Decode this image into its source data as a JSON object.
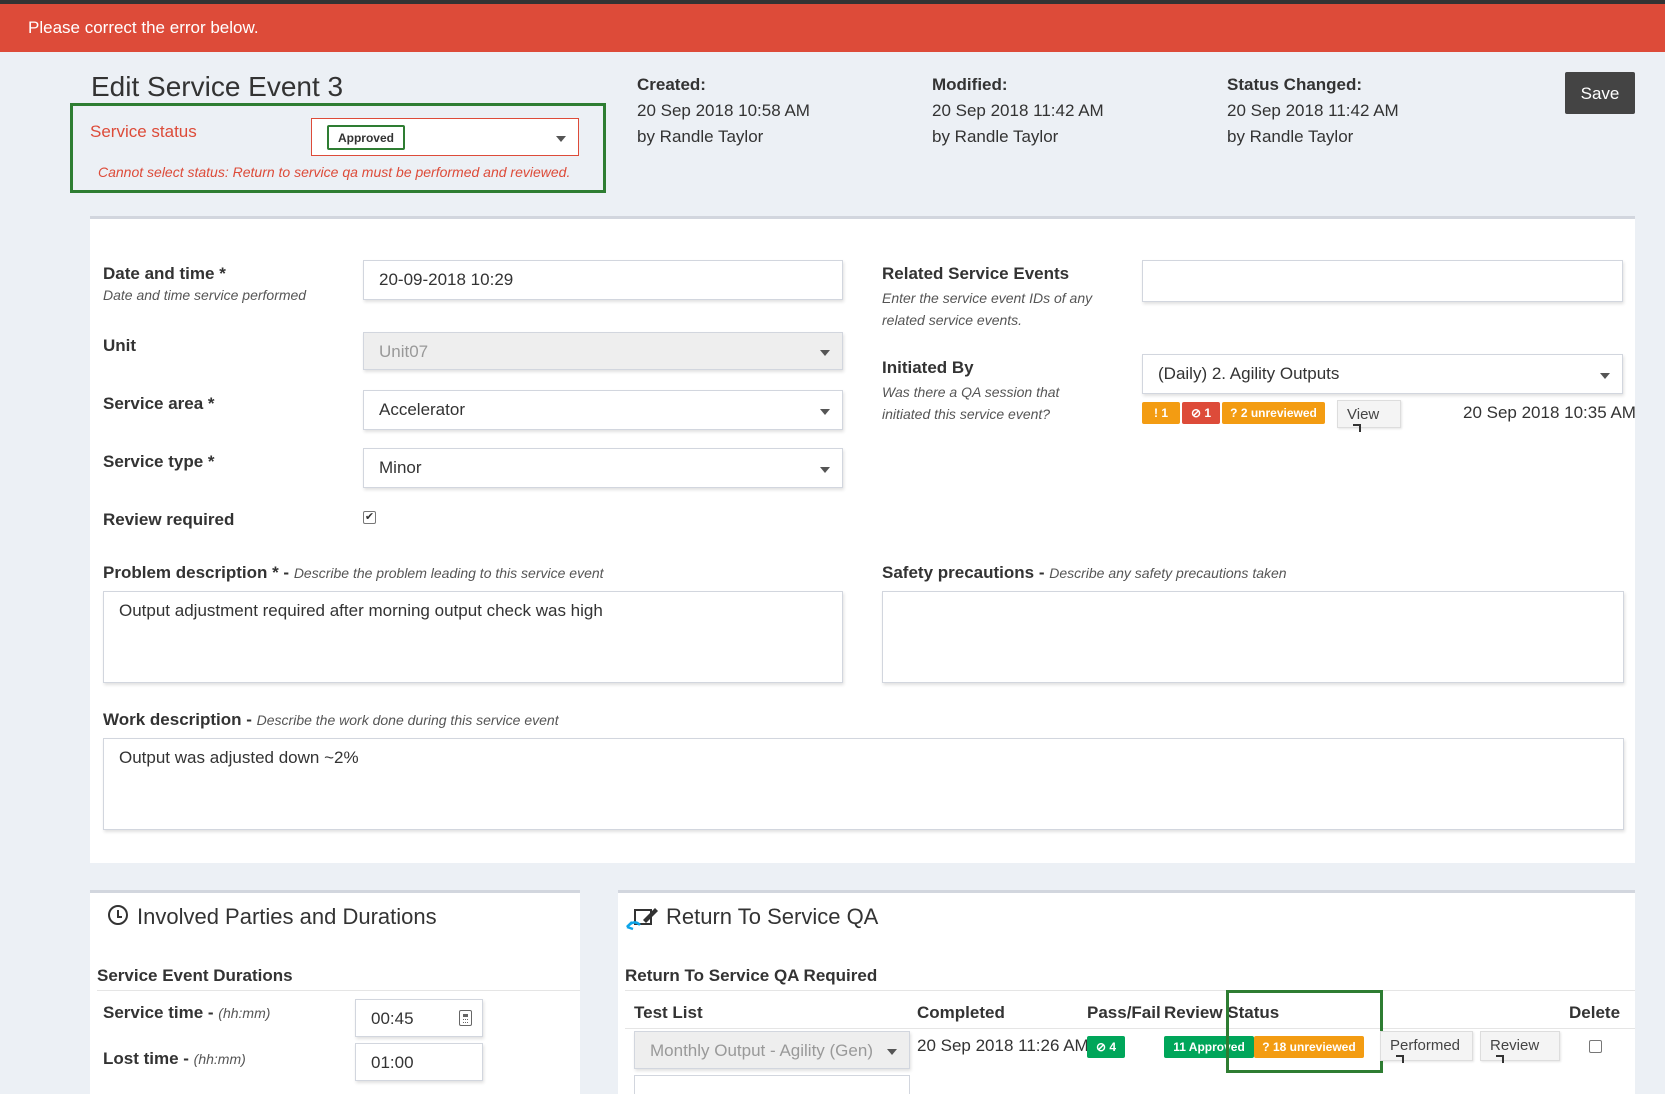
{
  "alert": {
    "message": "Please correct the error below."
  },
  "page": {
    "title": "Edit Service Event 3"
  },
  "status": {
    "label": "Service status",
    "selected": "Approved",
    "error": "Cannot select status: Return to service qa must be performed and reviewed."
  },
  "meta": {
    "created": {
      "heading": "Created:",
      "date": "20 Sep 2018 10:58 AM",
      "by": "by Randle Taylor"
    },
    "modified": {
      "heading": "Modified:",
      "date": "20 Sep 2018 11:42 AM",
      "by": "by Randle Taylor"
    },
    "status_changed": {
      "heading": "Status Changed:",
      "date": "20 Sep 2018 11:42 AM",
      "by": "by Randle Taylor"
    }
  },
  "toolbar": {
    "save_label": "Save"
  },
  "form": {
    "datetime": {
      "label": "Date and time *",
      "help": "Date and time service performed",
      "value": "20-09-2018 10:29"
    },
    "unit": {
      "label": "Unit",
      "value": "Unit07"
    },
    "service_area": {
      "label": "Service area *",
      "value": "Accelerator"
    },
    "service_type": {
      "label": "Service type *",
      "value": "Minor"
    },
    "review_required": {
      "label": "Review required",
      "checked": true
    },
    "related": {
      "label": "Related Service Events",
      "help": "Enter the service event IDs of any related service events.",
      "value": ""
    },
    "initiated_by": {
      "label": "Initiated By",
      "help": "Was there a QA session that initiated this service event?",
      "value": "(Daily) 2. Agility Outputs",
      "badges": [
        "1",
        "1",
        "2 unreviewed"
      ],
      "view_label": "View",
      "date": "20 Sep 2018 10:35 AM"
    },
    "problem": {
      "label": "Problem description *",
      "dash": " - ",
      "help": "Describe the problem leading to this service event",
      "value": "Output adjustment required after morning output check was high"
    },
    "safety": {
      "label": "Safety precautions",
      "dash": " - ",
      "help": "Describe any safety precautions taken",
      "value": ""
    },
    "work": {
      "label": "Work description",
      "dash": " - ",
      "help": "Describe the work done during this service event",
      "value": "Output was adjusted down ~2%"
    }
  },
  "parties": {
    "title": "Involved Parties and Durations",
    "durations_heading": "Service Event Durations",
    "service_time": {
      "label": "Service time",
      "dash": " - ",
      "help": "(hh:mm)",
      "value": "00:45"
    },
    "lost_time": {
      "label": "Lost time",
      "dash": " - ",
      "help": "(hh:mm)",
      "value": "01:00"
    }
  },
  "rtsqa": {
    "title": "Return To Service QA",
    "required_heading": "Return To Service QA Required",
    "columns": [
      "Test List",
      "Completed",
      "Pass/Fail",
      "Review Status",
      "Delete"
    ],
    "row": {
      "test_list": "Monthly Output - Agility (Gen)",
      "completed": "20 Sep 2018 11:26 AM",
      "pass_badge": "4",
      "approved_badge": "11 Approved",
      "unreviewed_badge": "18 unreviewed",
      "performed_label": "Performed",
      "review_label": "Review"
    }
  },
  "colors": {
    "alert": "#dd4b39",
    "highlight": "#2e7d32",
    "orange": "#f39c12",
    "green": "#00a65a"
  }
}
